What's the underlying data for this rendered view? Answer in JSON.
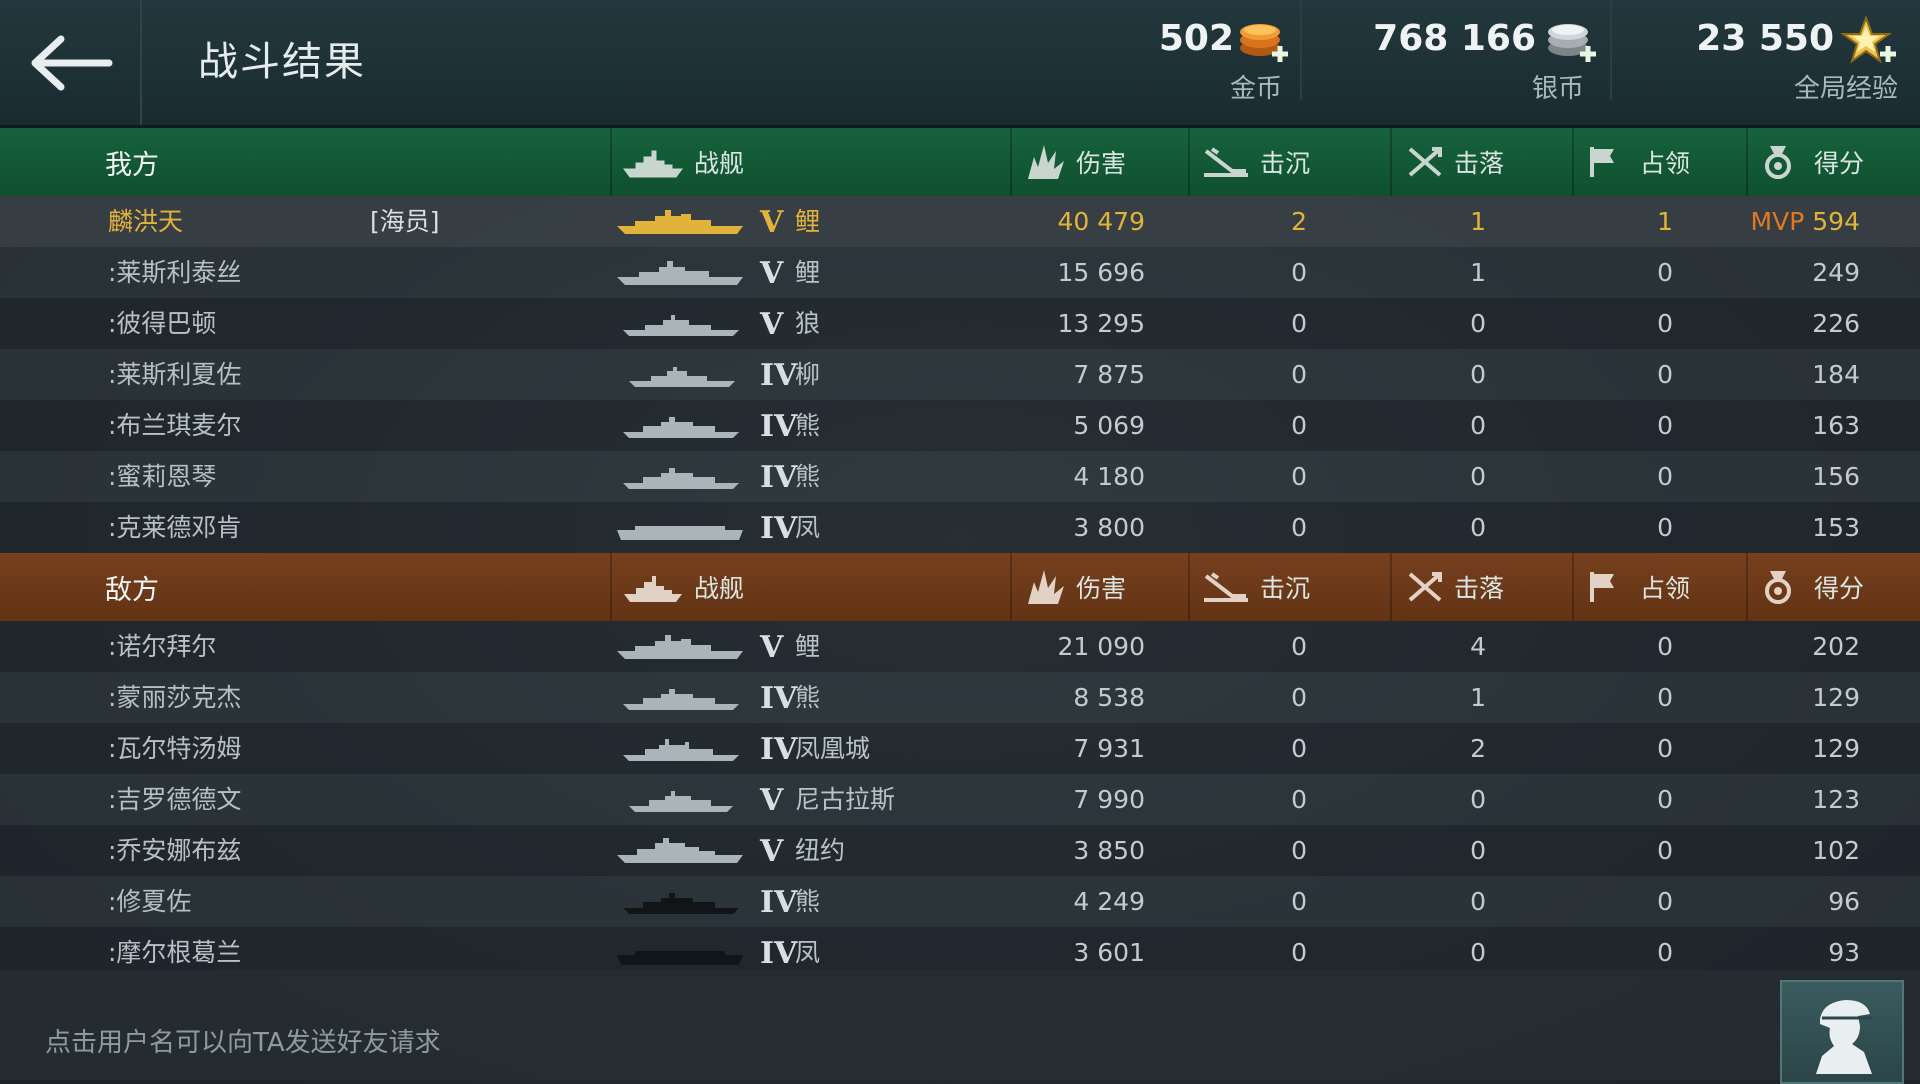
{
  "header": {
    "title": "战斗结果",
    "currencies": [
      {
        "amount": "502",
        "label": "金币",
        "icon": "gold-coin-plus-icon"
      },
      {
        "amount": "768 166",
        "label": "银币",
        "icon": "silver-coin-plus-icon"
      },
      {
        "amount": "23 550",
        "label": "全局经验",
        "icon": "star-plus-icon"
      }
    ]
  },
  "columns": {
    "ship": "战舰",
    "damage": "伤害",
    "sunk": "击沉",
    "downed": "击落",
    "capture": "占领",
    "score": "得分"
  },
  "friendly": {
    "label": "我方",
    "players": [
      {
        "name": "麟洪天",
        "role": "[海员]",
        "tier": "V",
        "ship": "鲤",
        "damage": "40 479",
        "sunk": "2",
        "downed": "1",
        "capture": "1",
        "mvp": "MVP",
        "score": "594"
      },
      {
        "name": ":莱斯利泰丝",
        "tier": "V",
        "ship": "鲤",
        "damage": "15 696",
        "sunk": "0",
        "downed": "1",
        "capture": "0",
        "score": "249"
      },
      {
        "name": ":彼得巴顿",
        "tier": "V",
        "ship": "狼",
        "damage": "13 295",
        "sunk": "0",
        "downed": "0",
        "capture": "0",
        "score": "226"
      },
      {
        "name": ":莱斯利夏佐",
        "tier": "IV",
        "ship": "柳",
        "damage": "7 875",
        "sunk": "0",
        "downed": "0",
        "capture": "0",
        "score": "184"
      },
      {
        "name": ":布兰琪麦尔",
        "tier": "IV",
        "ship": "熊",
        "damage": "5 069",
        "sunk": "0",
        "downed": "0",
        "capture": "0",
        "score": "163"
      },
      {
        "name": ":蜜莉恩琴",
        "tier": "IV",
        "ship": "熊",
        "damage": "4 180",
        "sunk": "0",
        "downed": "0",
        "capture": "0",
        "score": "156"
      },
      {
        "name": ":克莱德邓肯",
        "tier": "IV",
        "ship": "凤",
        "damage": "3 800",
        "sunk": "0",
        "downed": "0",
        "capture": "0",
        "score": "153"
      }
    ]
  },
  "enemy": {
    "label": "敌方",
    "players": [
      {
        "name": ":诺尔拜尔",
        "tier": "V",
        "ship": "鲤",
        "damage": "21 090",
        "sunk": "0",
        "downed": "4",
        "capture": "0",
        "score": "202"
      },
      {
        "name": ":蒙丽莎克杰",
        "tier": "IV",
        "ship": "熊",
        "damage": "8 538",
        "sunk": "0",
        "downed": "1",
        "capture": "0",
        "score": "129"
      },
      {
        "name": ":瓦尔特汤姆",
        "tier": "IV",
        "ship": "凤凰城",
        "damage": "7 931",
        "sunk": "0",
        "downed": "2",
        "capture": "0",
        "score": "129"
      },
      {
        "name": ":吉罗德德文",
        "tier": "V",
        "ship": "尼古拉斯",
        "damage": "7 990",
        "sunk": "0",
        "downed": "0",
        "capture": "0",
        "score": "123"
      },
      {
        "name": ":乔安娜布兹",
        "tier": "V",
        "ship": "纽约",
        "damage": "3 850",
        "sunk": "0",
        "downed": "0",
        "capture": "0",
        "score": "102"
      },
      {
        "name": ":修夏佐",
        "tier": "IV",
        "ship": "熊",
        "damage": "4 249",
        "sunk": "0",
        "downed": "0",
        "capture": "0",
        "score": "96"
      },
      {
        "name": ":摩尔根葛兰",
        "tier": "IV",
        "ship": "凤",
        "damage": "3 601",
        "sunk": "0",
        "downed": "0",
        "capture": "0",
        "score": "93"
      }
    ]
  },
  "footer": {
    "hint": "点击用户名可以向TA发送好友请求",
    "captain_icon": "captain-silhouette-icon"
  },
  "colors": {
    "friendly_header": "#16623c",
    "enemy_header": "#76401e",
    "highlight_text": "#e2b33b",
    "mvp": "#e07a20"
  }
}
